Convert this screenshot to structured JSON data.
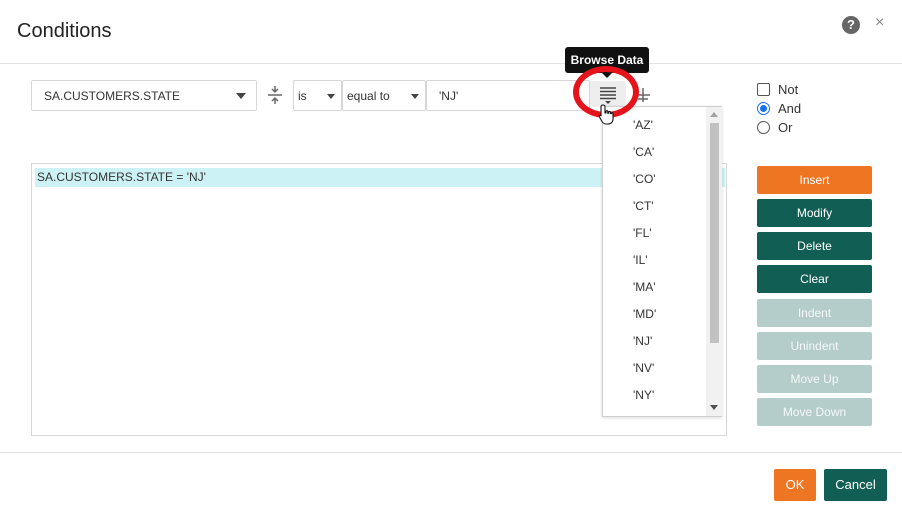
{
  "dialog": {
    "title": "Conditions",
    "help_icon_glyph": "?",
    "close_icon_glyph": "×"
  },
  "condition_builder": {
    "column_value": "SA.CUSTOMERS.STATE",
    "negation_value": "is",
    "operator_value": "equal to",
    "value_field": "'NJ'"
  },
  "tooltip": {
    "text": "Browse Data"
  },
  "browse_dropdown": {
    "items": [
      "'AZ'",
      "'CA'",
      "'CO'",
      "'CT'",
      "'FL'",
      "'IL'",
      "'MA'",
      "'MD'",
      "'NJ'",
      "'NV'",
      "'NY'"
    ]
  },
  "conditions_list": {
    "rows": [
      "SA.CUSTOMERS.STATE = 'NJ'"
    ]
  },
  "logic_options": {
    "not_label": "Not",
    "and_label": "And",
    "or_label": "Or",
    "not_checked": false,
    "selected": "And"
  },
  "action_buttons": {
    "insert": "Insert",
    "modify": "Modify",
    "delete": "Delete",
    "clear": "Clear",
    "indent": "Indent",
    "unindent": "Unindent",
    "move_up": "Move Up",
    "move_down": "Move Down"
  },
  "footer": {
    "ok": "OK",
    "cancel": "Cancel"
  },
  "colors": {
    "accent_orange": "#ee7623",
    "primary_teal": "#115e54",
    "disabled_teal": "#b4cdcb",
    "selected_row": "#cdf2f5",
    "highlight_red": "#e5141b"
  },
  "icons": {
    "help": "help-circle-icon",
    "close": "close-icon",
    "operator_left": "split-operator-icon",
    "browse": "list-lines-icon",
    "operator_right": "add-operator-icon",
    "cursor": "hand-pointer-icon"
  }
}
